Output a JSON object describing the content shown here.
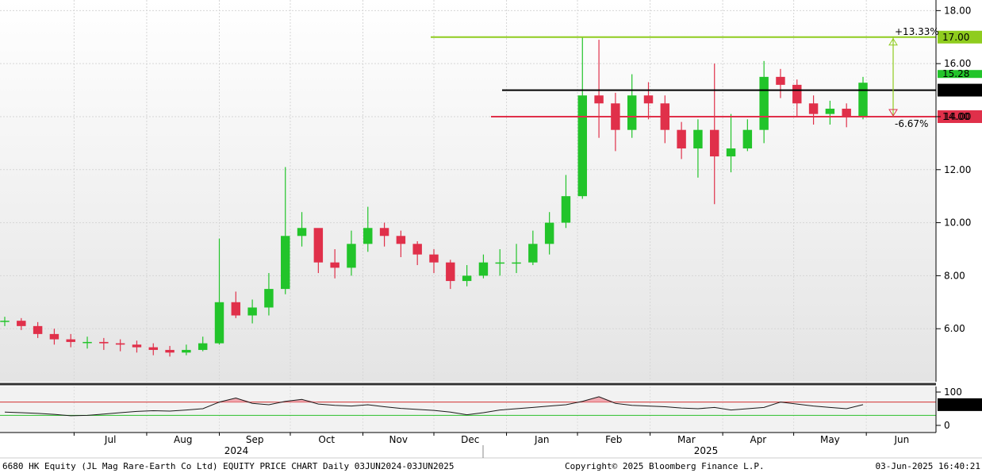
{
  "footer": {
    "left": "6680 HK Equity (JL Mag Rare-Earth Co Ltd) EQUITY PRICE CHART  Daily 03JUN2024-03JUN2025",
    "center": "Copyright© 2025 Bloomberg Finance L.P.",
    "right": "03-Jun-2025 16:40:21"
  },
  "year_labels": [
    "2024",
    "2025"
  ],
  "colors": {
    "up": "#22c42a",
    "down": "#e0304a",
    "resistance": "#8fcc1e",
    "support": "#e0304a",
    "pivot": "#000000",
    "rsi_line": "#1a1a1a",
    "rsi_upper": "#d32f2f",
    "rsi_lower": "#2bbf2b"
  },
  "chart_data": [
    {
      "type": "candlestick",
      "title": "",
      "x_tick_labels": [
        "Jul",
        "Aug",
        "Sep",
        "Oct",
        "Nov",
        "Dec",
        "Jan",
        "Feb",
        "Mar",
        "Apr",
        "May",
        "Jun"
      ],
      "y_tick_labels": [
        "6.00",
        "8.00",
        "10.00",
        "12.00",
        "14.00",
        "16.00",
        "18.00"
      ],
      "ylim": [
        4.0,
        18.4
      ],
      "grid": true,
      "hlines": [
        {
          "name": "resistance",
          "value": 17.0,
          "label": "17.00",
          "pct_label": "+13.33%"
        },
        {
          "name": "pivot",
          "value": 15.0,
          "label": "15.00"
        },
        {
          "name": "support",
          "value": 14.0,
          "label": "14.00",
          "pct_label": "-6.67%"
        }
      ],
      "last_price_label": "15.28",
      "x": [
        "Jun-03",
        "Jun-10",
        "Jun-17",
        "Jun-24",
        "Jul-01",
        "Jul-08",
        "Jul-15",
        "Jul-22",
        "Jul-29",
        "Aug-05",
        "Aug-12",
        "Aug-19",
        "Aug-26",
        "Sep-02",
        "Sep-09",
        "Sep-16",
        "Sep-23",
        "Sep-30",
        "Oct-07",
        "Oct-14",
        "Oct-21",
        "Oct-28",
        "Nov-04",
        "Nov-11",
        "Nov-18",
        "Nov-25",
        "Dec-02",
        "Dec-09",
        "Dec-16",
        "Dec-23",
        "Dec-30",
        "Jan-06",
        "Jan-13",
        "Jan-20",
        "Jan-27",
        "Feb-03",
        "Feb-10",
        "Feb-17",
        "Feb-24",
        "Mar-03",
        "Mar-10",
        "Mar-17",
        "Mar-24",
        "Mar-31",
        "Apr-07",
        "Apr-14",
        "Apr-21",
        "Apr-28",
        "May-05",
        "May-12",
        "May-19",
        "May-26",
        "Jun-02"
      ],
      "open": [
        6.3,
        6.3,
        6.1,
        5.8,
        5.6,
        5.5,
        5.5,
        5.45,
        5.4,
        5.3,
        5.2,
        5.1,
        5.2,
        5.45,
        7.0,
        6.5,
        6.8,
        7.5,
        9.5,
        9.8,
        8.5,
        8.3,
        9.2,
        9.8,
        9.5,
        9.2,
        8.8,
        8.5,
        7.8,
        8.0,
        8.5,
        8.5,
        8.5,
        9.2,
        10.0,
        11.0,
        14.8,
        14.5,
        13.5,
        14.8,
        14.5,
        13.5,
        12.8,
        13.5,
        12.5,
        12.8,
        13.5,
        15.5,
        15.2,
        14.5,
        14.1,
        14.3,
        14.0
      ],
      "close": [
        6.3,
        6.1,
        5.8,
        5.6,
        5.5,
        5.5,
        5.45,
        5.4,
        5.3,
        5.2,
        5.1,
        5.2,
        5.45,
        7.0,
        6.5,
        6.8,
        7.5,
        9.5,
        9.8,
        8.5,
        8.3,
        9.2,
        9.8,
        9.5,
        9.2,
        8.8,
        8.5,
        7.8,
        8.0,
        8.5,
        8.5,
        8.5,
        9.2,
        10.0,
        11.0,
        14.8,
        14.5,
        13.5,
        14.8,
        14.5,
        13.5,
        12.8,
        13.5,
        12.5,
        12.8,
        13.5,
        15.5,
        15.2,
        14.5,
        14.1,
        14.3,
        14.0,
        15.28
      ],
      "high": [
        6.45,
        6.4,
        6.25,
        6.0,
        5.8,
        5.7,
        5.65,
        5.6,
        5.55,
        5.45,
        5.35,
        5.4,
        5.7,
        9.4,
        7.4,
        7.1,
        8.1,
        12.1,
        10.4,
        9.6,
        9.0,
        9.7,
        10.6,
        10.0,
        9.7,
        9.3,
        9.0,
        8.6,
        8.4,
        8.8,
        9.0,
        9.2,
        9.7,
        10.4,
        11.8,
        17.0,
        16.9,
        14.9,
        15.6,
        15.3,
        14.8,
        13.8,
        13.9,
        16.0,
        14.1,
        13.9,
        16.1,
        15.8,
        15.4,
        14.8,
        14.6,
        14.5,
        15.5
      ],
      "low": [
        6.1,
        5.95,
        5.65,
        5.4,
        5.3,
        5.25,
        5.2,
        5.15,
        5.1,
        5.0,
        4.95,
        5.0,
        5.15,
        5.4,
        6.4,
        6.2,
        6.5,
        7.3,
        9.1,
        8.1,
        7.9,
        8.0,
        8.9,
        9.1,
        8.7,
        8.4,
        8.1,
        7.5,
        7.6,
        7.9,
        8.0,
        8.1,
        8.4,
        8.8,
        9.8,
        10.9,
        13.2,
        12.7,
        13.2,
        13.9,
        13.0,
        12.4,
        11.7,
        10.7,
        11.9,
        12.7,
        13.0,
        14.7,
        14.0,
        13.7,
        13.7,
        13.6,
        13.9
      ]
    },
    {
      "type": "line",
      "title": "",
      "name": "RSI",
      "y_tick_labels": [
        "0",
        "100"
      ],
      "ylim": [
        0,
        100
      ],
      "upper_band": 70,
      "lower_band": 30,
      "last_value_label": "62.1754",
      "x": [
        "Jun-03",
        "Jun-10",
        "Jun-17",
        "Jun-24",
        "Jul-01",
        "Jul-08",
        "Jul-15",
        "Jul-22",
        "Jul-29",
        "Aug-05",
        "Aug-12",
        "Aug-19",
        "Aug-26",
        "Sep-02",
        "Sep-09",
        "Sep-16",
        "Sep-23",
        "Sep-30",
        "Oct-07",
        "Oct-14",
        "Oct-21",
        "Oct-28",
        "Nov-04",
        "Nov-11",
        "Nov-18",
        "Nov-25",
        "Dec-02",
        "Dec-09",
        "Dec-16",
        "Dec-23",
        "Dec-30",
        "Jan-06",
        "Jan-13",
        "Jan-20",
        "Jan-27",
        "Feb-03",
        "Feb-10",
        "Feb-17",
        "Feb-24",
        "Mar-03",
        "Mar-10",
        "Mar-17",
        "Mar-24",
        "Mar-31",
        "Apr-07",
        "Apr-14",
        "Apr-21",
        "Apr-28",
        "May-05",
        "May-12",
        "May-19",
        "May-26",
        "Jun-02"
      ],
      "values": [
        40,
        38,
        36,
        33,
        29,
        30,
        34,
        38,
        42,
        44,
        43,
        46,
        50,
        70,
        82,
        66,
        62,
        72,
        78,
        64,
        60,
        58,
        62,
        56,
        51,
        48,
        45,
        40,
        32,
        38,
        46,
        50,
        54,
        58,
        62,
        72,
        86,
        66,
        60,
        58,
        56,
        52,
        50,
        54,
        46,
        50,
        54,
        70,
        64,
        58,
        54,
        50,
        62.18
      ]
    }
  ]
}
